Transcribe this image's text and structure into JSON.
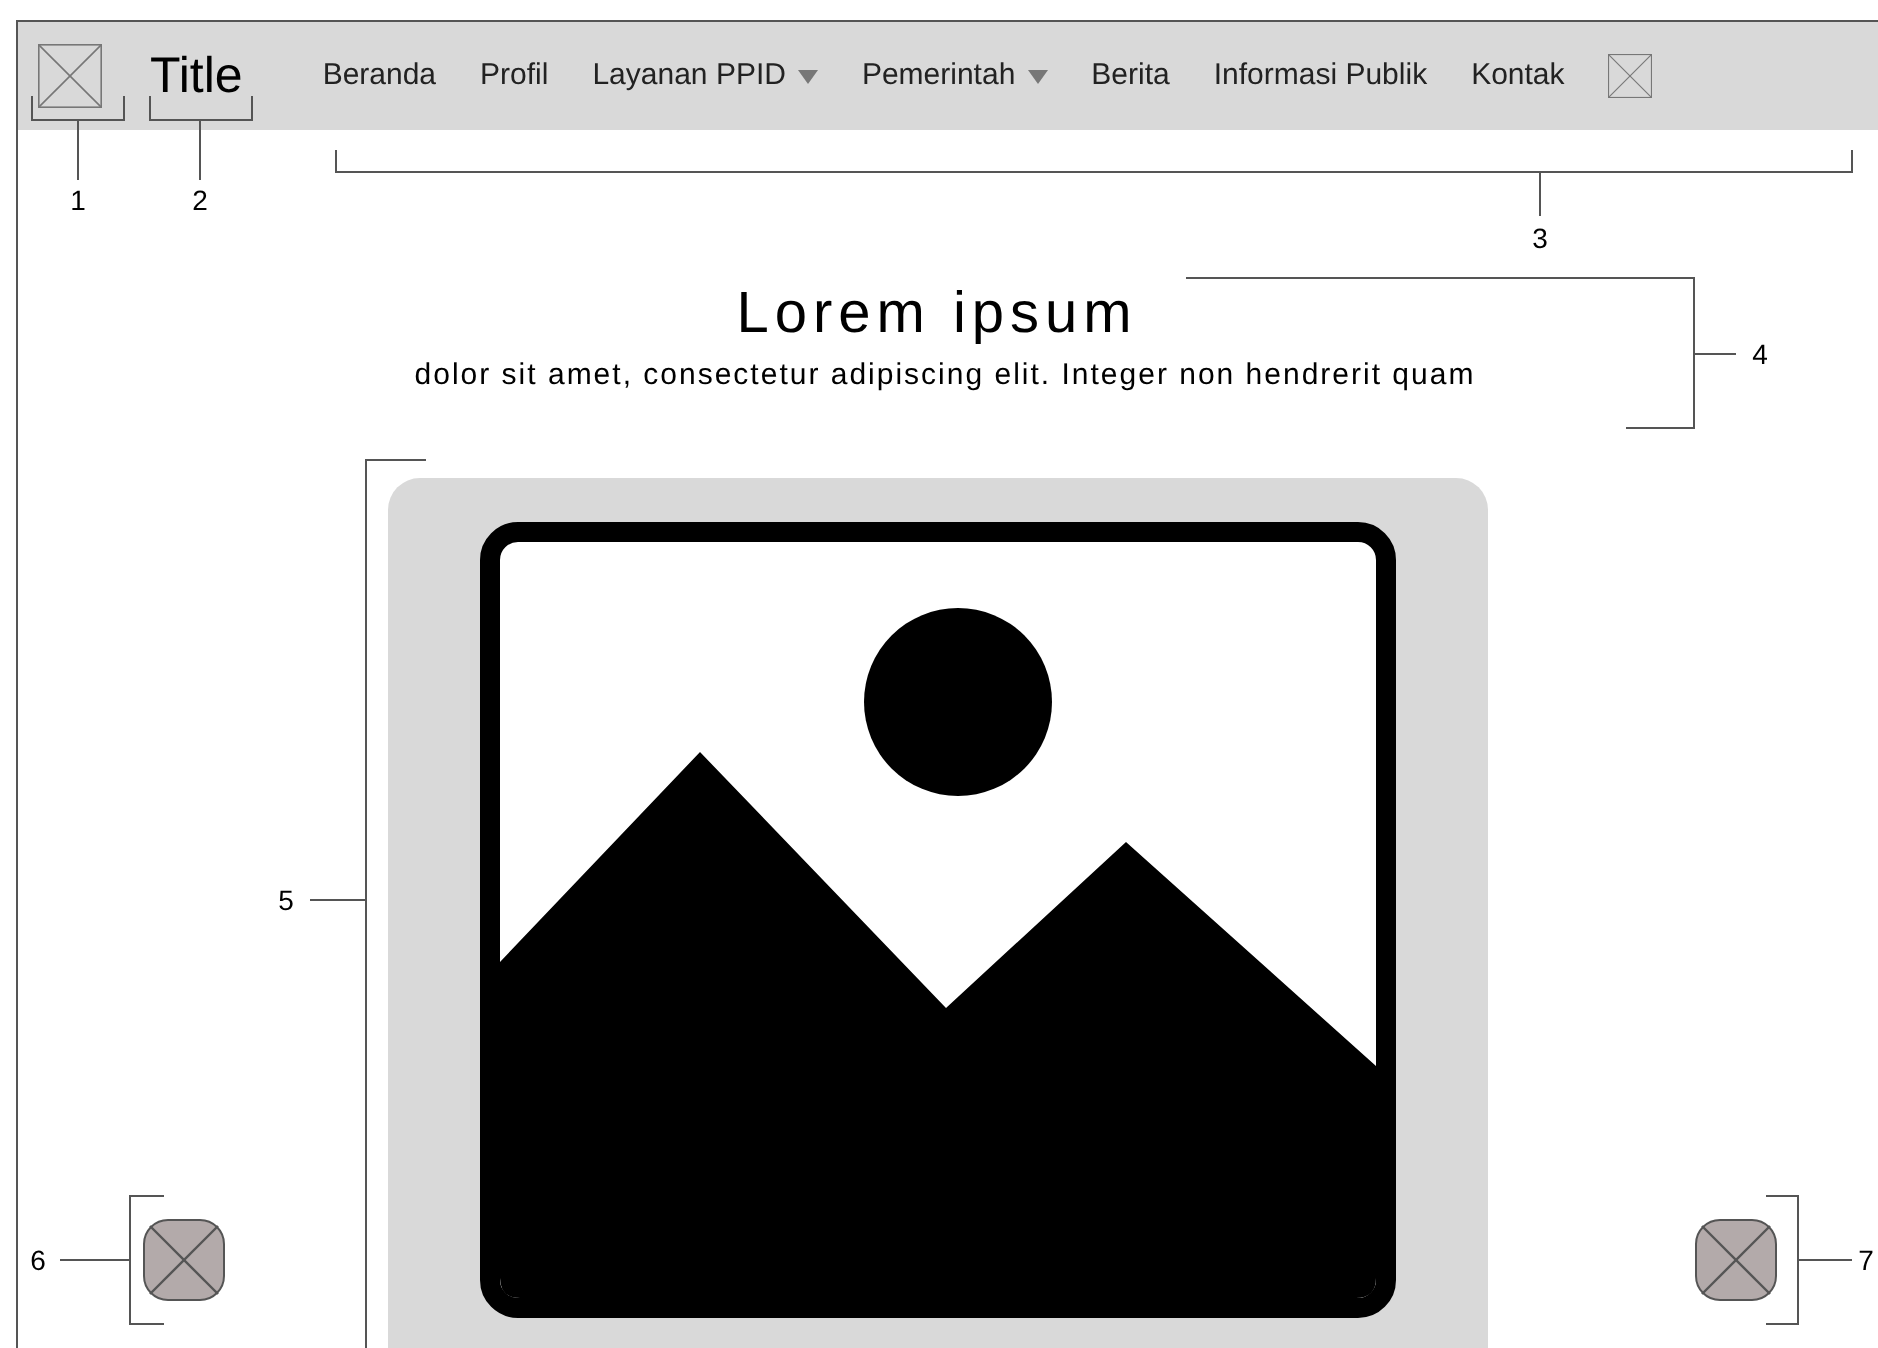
{
  "header": {
    "title": "Title",
    "nav_items": [
      {
        "label": "Beranda",
        "has_dropdown": false
      },
      {
        "label": "Profil",
        "has_dropdown": false
      },
      {
        "label": "Layanan PPID",
        "has_dropdown": true
      },
      {
        "label": "Pemerintah",
        "has_dropdown": true
      },
      {
        "label": "Berita",
        "has_dropdown": false
      },
      {
        "label": "Informasi Publik",
        "has_dropdown": false
      },
      {
        "label": "Kontak",
        "has_dropdown": false
      }
    ]
  },
  "hero": {
    "heading": "Lorem ipsum",
    "subheading": "dolor sit amet, consectetur adipiscing elit. Integer non hendrerit quam"
  },
  "annotations": [
    "1",
    "2",
    "3",
    "4",
    "5",
    "6",
    "7"
  ]
}
